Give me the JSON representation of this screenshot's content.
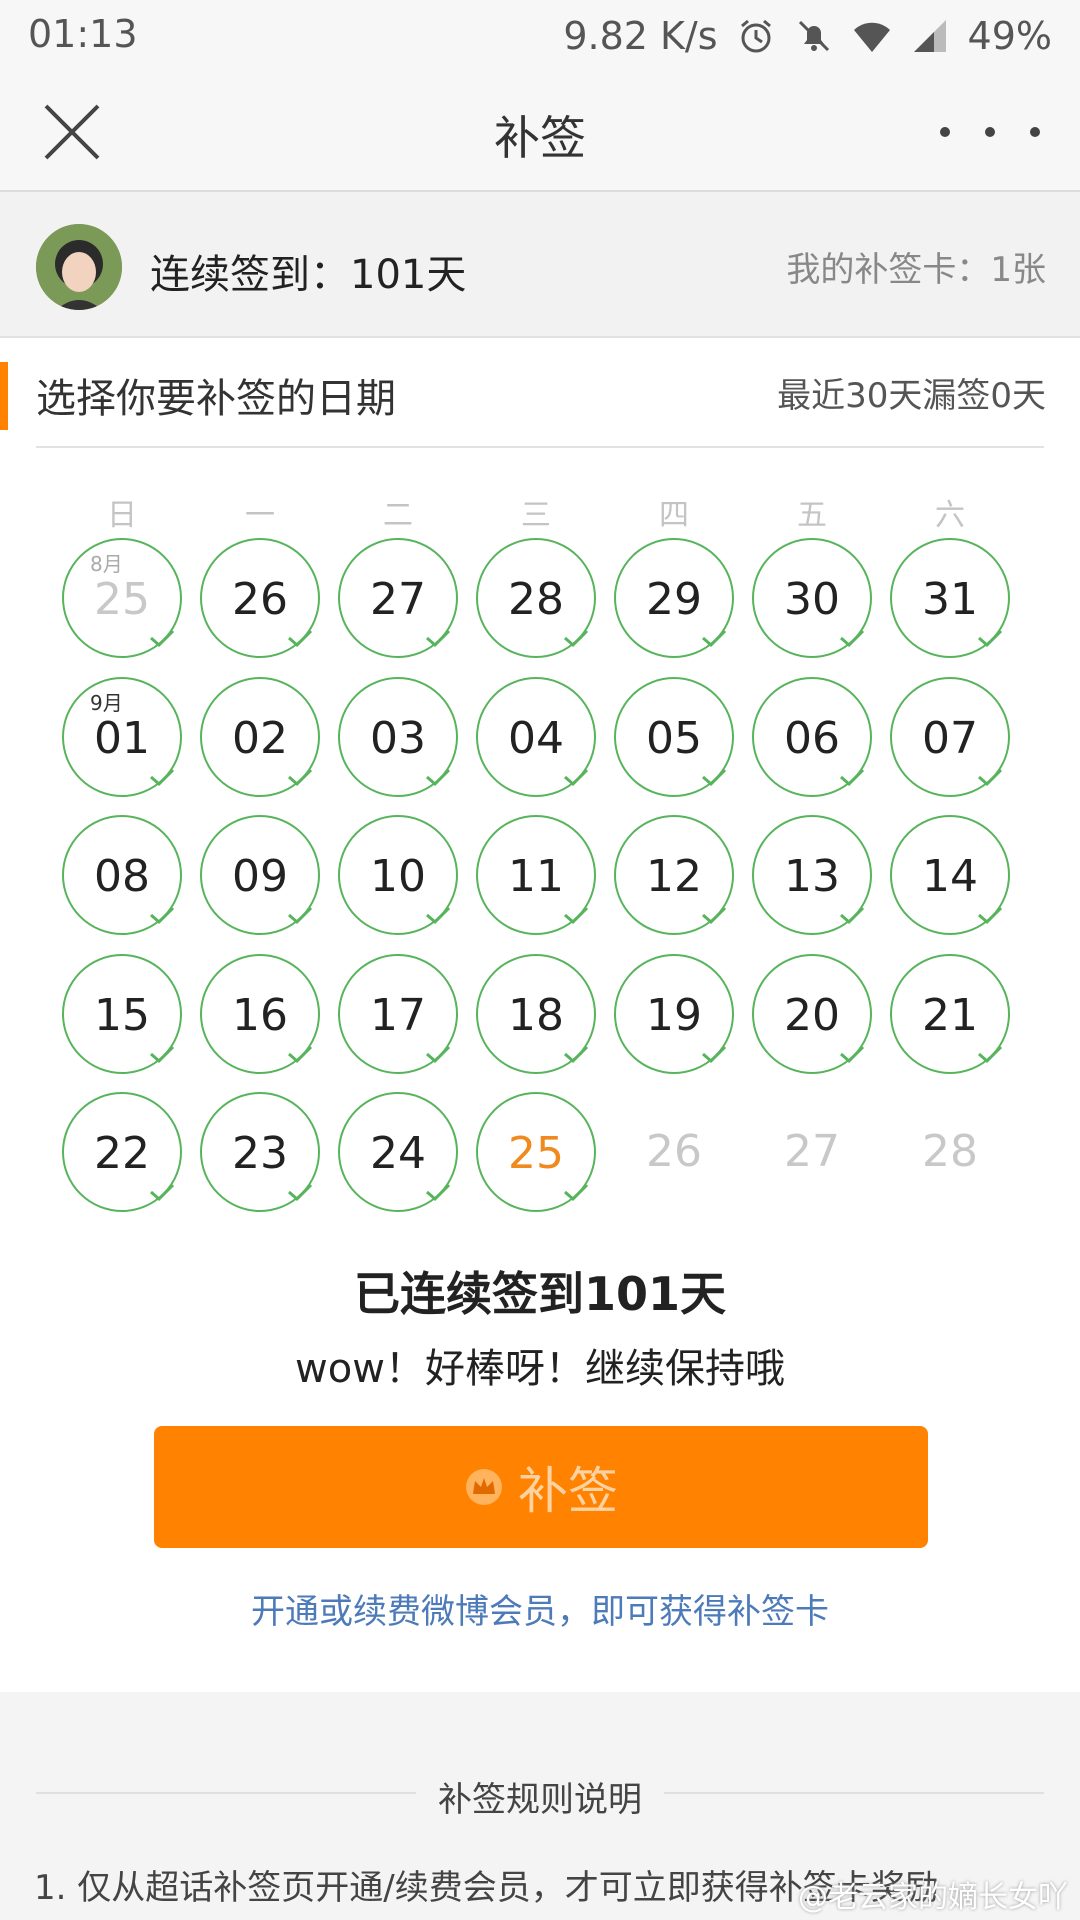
{
  "status_bar": {
    "time": "01:13",
    "net_speed": "9.82 K/s",
    "battery": "49%",
    "icons": [
      "alarm-icon",
      "bell-muted-icon",
      "wifi-icon",
      "signal-icon"
    ]
  },
  "nav": {
    "title": "补签",
    "close_icon": "close-icon",
    "more_icon": "more-icon"
  },
  "user": {
    "streak_label": "连续签到：101天",
    "card_count": "我的补签卡：1张"
  },
  "section": {
    "title": "选择你要补签的日期",
    "missed": "最近30天漏签0天"
  },
  "calendar": {
    "weekdays": [
      "日",
      "一",
      "二",
      "三",
      "四",
      "五",
      "六"
    ],
    "days": [
      {
        "num": "25",
        "month": "8月",
        "state": "past-month"
      },
      {
        "num": "26",
        "month": "",
        "state": "signed"
      },
      {
        "num": "27",
        "month": "",
        "state": "signed"
      },
      {
        "num": "28",
        "month": "",
        "state": "signed"
      },
      {
        "num": "29",
        "month": "",
        "state": "signed"
      },
      {
        "num": "30",
        "month": "",
        "state": "signed"
      },
      {
        "num": "31",
        "month": "",
        "state": "signed"
      },
      {
        "num": "01",
        "month": "9月",
        "state": "signed"
      },
      {
        "num": "02",
        "month": "",
        "state": "signed"
      },
      {
        "num": "03",
        "month": "",
        "state": "signed"
      },
      {
        "num": "04",
        "month": "",
        "state": "signed"
      },
      {
        "num": "05",
        "month": "",
        "state": "signed"
      },
      {
        "num": "06",
        "month": "",
        "state": "signed"
      },
      {
        "num": "07",
        "month": "",
        "state": "signed"
      },
      {
        "num": "08",
        "month": "",
        "state": "signed"
      },
      {
        "num": "09",
        "month": "",
        "state": "signed"
      },
      {
        "num": "10",
        "month": "",
        "state": "signed"
      },
      {
        "num": "11",
        "month": "",
        "state": "signed"
      },
      {
        "num": "12",
        "month": "",
        "state": "signed"
      },
      {
        "num": "13",
        "month": "",
        "state": "signed"
      },
      {
        "num": "14",
        "month": "",
        "state": "signed"
      },
      {
        "num": "15",
        "month": "",
        "state": "signed"
      },
      {
        "num": "16",
        "month": "",
        "state": "signed"
      },
      {
        "num": "17",
        "month": "",
        "state": "signed"
      },
      {
        "num": "18",
        "month": "",
        "state": "signed"
      },
      {
        "num": "19",
        "month": "",
        "state": "signed"
      },
      {
        "num": "20",
        "month": "",
        "state": "signed"
      },
      {
        "num": "21",
        "month": "",
        "state": "signed"
      },
      {
        "num": "22",
        "month": "",
        "state": "signed"
      },
      {
        "num": "23",
        "month": "",
        "state": "signed"
      },
      {
        "num": "24",
        "month": "",
        "state": "signed"
      },
      {
        "num": "25",
        "month": "",
        "state": "today"
      },
      {
        "num": "26",
        "month": "",
        "state": "future"
      },
      {
        "num": "27",
        "month": "",
        "state": "future"
      },
      {
        "num": "28",
        "month": "",
        "state": "future"
      }
    ]
  },
  "summary": {
    "title": "已连续签到101天",
    "subtitle": "wow！好棒呀！继续保持哦"
  },
  "makeup_button": {
    "label": "补签",
    "icon": "crown-icon"
  },
  "member_link": "开通或续费微博会员，即可获得补签卡",
  "rules": {
    "title": "补签规则说明",
    "item_1": "1. 仅从超话补签页开通/续费会员，才可立即获得补签卡奖励"
  },
  "watermark": "@老云家的嫡长女吖",
  "colors": {
    "accent": "#ff8200",
    "signed_ring": "#58b45c",
    "today_text": "#f08a1e",
    "link": "#4d7ab8"
  }
}
